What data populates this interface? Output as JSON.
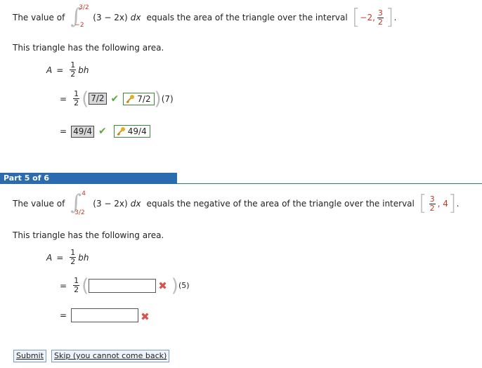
{
  "part4": {
    "intro_text": "The value of",
    "upper_limit": "3/2",
    "lower_limit": "−2",
    "integrand": "(3 − 2x)",
    "dx": "dx",
    "equals_text": "equals the area of the triangle over the interval",
    "interval_a": "−2,",
    "interval_b_num": "3",
    "interval_b_den": "2",
    "period": ".",
    "area_sentence": "This triangle has the following area.",
    "A": "A",
    "eq": "=",
    "half_num": "1",
    "half_den": "2",
    "bh": "bh",
    "ans_base": "7/2",
    "correct_base": "7/2",
    "height": "(7)",
    "ans_area": "49/4",
    "correct_area": "49/4"
  },
  "part5": {
    "header": "Part 5 of 6",
    "intro_text": "The value of",
    "upper_limit": "4",
    "lower_limit": "3/2",
    "integrand": "(3 − 2x)",
    "dx": "dx",
    "equals_text": "equals the negative of the area of the triangle over the interval",
    "interval_a_num": "3",
    "interval_a_den": "2",
    "interval_b": ", 4",
    "period": ".",
    "area_sentence": "This triangle has the following area.",
    "A": "A",
    "eq": "=",
    "half_num": "1",
    "half_den": "2",
    "bh": "bh",
    "input_base": "",
    "height": "(5)",
    "input_area": ""
  },
  "buttons": {
    "submit": "Submit",
    "skip": "Skip (you cannot come back)"
  },
  "colors": {
    "header_bg": "#2b6cb0",
    "correct": "#5aab3d",
    "incorrect": "#d9534f"
  }
}
